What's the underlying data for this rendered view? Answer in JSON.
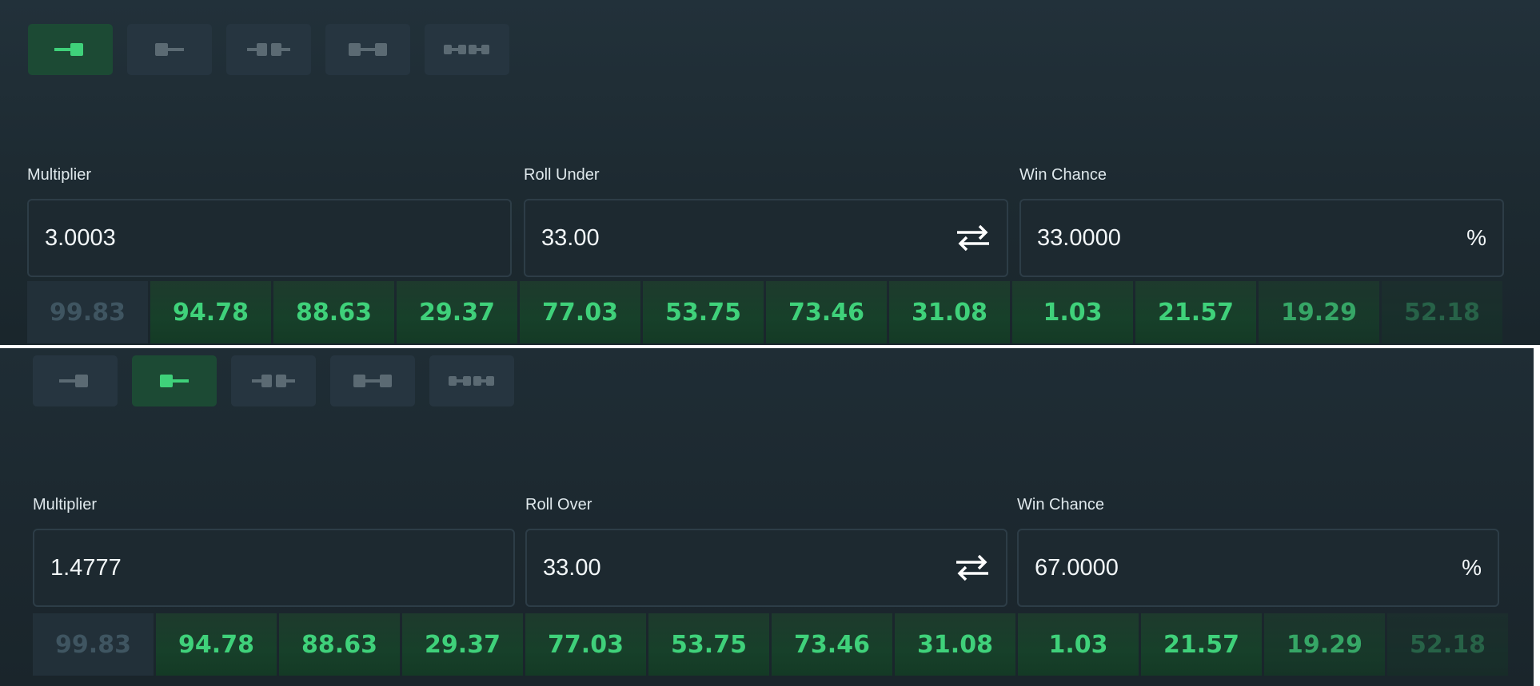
{
  "panels": [
    {
      "tabs": [
        {
          "icon": "roll-under-icon",
          "active": true
        },
        {
          "icon": "roll-over-icon",
          "active": false
        },
        {
          "icon": "outside-range-icon",
          "active": false
        },
        {
          "icon": "between-range-icon",
          "active": false
        },
        {
          "icon": "between-two-ranges-icon",
          "active": false
        }
      ],
      "multiplier": {
        "label": "Multiplier",
        "value": "3.0003"
      },
      "roll": {
        "label": "Roll Under",
        "value": "33.00"
      },
      "win_chance": {
        "label": "Win Chance",
        "value": "33.0000",
        "suffix": "%"
      },
      "history": [
        "99.83",
        "94.78",
        "88.63",
        "29.37",
        "77.03",
        "53.75",
        "73.46",
        "31.08",
        "1.03",
        "21.57",
        "19.29",
        "52.18"
      ]
    },
    {
      "tabs": [
        {
          "icon": "roll-under-icon",
          "active": false
        },
        {
          "icon": "roll-over-icon",
          "active": true
        },
        {
          "icon": "outside-range-icon",
          "active": false
        },
        {
          "icon": "between-range-icon",
          "active": false
        },
        {
          "icon": "between-two-ranges-icon",
          "active": false
        }
      ],
      "multiplier": {
        "label": "Multiplier",
        "value": "1.4777"
      },
      "roll": {
        "label": "Roll Over",
        "value": "33.00"
      },
      "win_chance": {
        "label": "Win Chance",
        "value": "67.0000",
        "suffix": "%"
      },
      "history": [
        "99.83",
        "94.78",
        "88.63",
        "29.37",
        "77.03",
        "53.75",
        "73.46",
        "31.08",
        "1.03",
        "21.57",
        "19.29",
        "52.18"
      ]
    }
  ],
  "colors": {
    "accent": "#3fd17a",
    "inactive": "#5b6a73",
    "background": "#1e2a30"
  }
}
